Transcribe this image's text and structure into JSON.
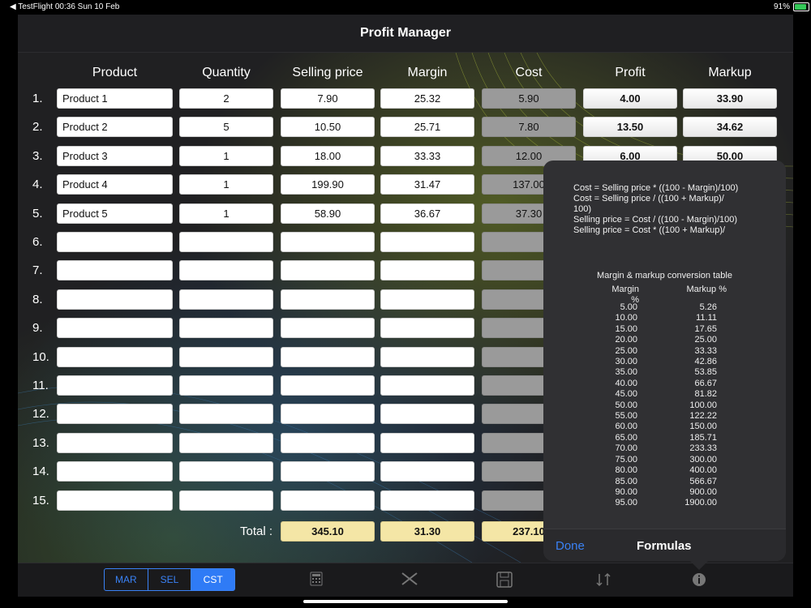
{
  "status": {
    "left": "◀ TestFlight   00:36   Sun 10 Feb",
    "right": "91%"
  },
  "app": {
    "title": "Profit Manager"
  },
  "headers": [
    "Product",
    "Quantity",
    "Selling price",
    "Margin",
    "Cost",
    "Profit",
    "Markup"
  ],
  "rows": [
    {
      "num": "1.",
      "product": "Product 1",
      "qty": "2",
      "sell": "7.90",
      "margin": "25.32",
      "cost": "5.90",
      "profit": "4.00",
      "markup": "33.90"
    },
    {
      "num": "2.",
      "product": "Product 2",
      "qty": "5",
      "sell": "10.50",
      "margin": "25.71",
      "cost": "7.80",
      "profit": "13.50",
      "markup": "34.62"
    },
    {
      "num": "3.",
      "product": "Product 3",
      "qty": "1",
      "sell": "18.00",
      "margin": "33.33",
      "cost": "12.00",
      "profit": "6.00",
      "markup": "50.00"
    },
    {
      "num": "4.",
      "product": "Product 4",
      "qty": "1",
      "sell": "199.90",
      "margin": "31.47",
      "cost": "137.00",
      "profit": "",
      "markup": ""
    },
    {
      "num": "5.",
      "product": "Product 5",
      "qty": "1",
      "sell": "58.90",
      "margin": "36.67",
      "cost": "37.30",
      "profit": "",
      "markup": ""
    },
    {
      "num": "6.",
      "product": "",
      "qty": "",
      "sell": "",
      "margin": "",
      "cost": "",
      "profit": "",
      "markup": ""
    },
    {
      "num": "7.",
      "product": "",
      "qty": "",
      "sell": "",
      "margin": "",
      "cost": "",
      "profit": "",
      "markup": ""
    },
    {
      "num": "8.",
      "product": "",
      "qty": "",
      "sell": "",
      "margin": "",
      "cost": "",
      "profit": "",
      "markup": ""
    },
    {
      "num": "9.",
      "product": "",
      "qty": "",
      "sell": "",
      "margin": "",
      "cost": "",
      "profit": "",
      "markup": ""
    },
    {
      "num": "10.",
      "product": "",
      "qty": "",
      "sell": "",
      "margin": "",
      "cost": "",
      "profit": "",
      "markup": ""
    },
    {
      "num": "11.",
      "product": "",
      "qty": "",
      "sell": "",
      "margin": "",
      "cost": "",
      "profit": "",
      "markup": ""
    },
    {
      "num": "12.",
      "product": "",
      "qty": "",
      "sell": "",
      "margin": "",
      "cost": "",
      "profit": "",
      "markup": ""
    },
    {
      "num": "13.",
      "product": "",
      "qty": "",
      "sell": "",
      "margin": "",
      "cost": "",
      "profit": "",
      "markup": ""
    },
    {
      "num": "14.",
      "product": "",
      "qty": "",
      "sell": "",
      "margin": "",
      "cost": "",
      "profit": "",
      "markup": ""
    },
    {
      "num": "15.",
      "product": "",
      "qty": "",
      "sell": "",
      "margin": "",
      "cost": "",
      "profit": "",
      "markup": ""
    }
  ],
  "totals": {
    "label": "Total :",
    "sell": "345.10",
    "margin": "31.30",
    "cost": "237.10"
  },
  "toolbar": {
    "segments": [
      "MAR",
      "SEL",
      "CST"
    ],
    "selected": "CST",
    "icons": [
      "calculator-icon",
      "scissors-icon",
      "save-icon",
      "swap-icon",
      "info-icon"
    ]
  },
  "popover": {
    "formulas": [
      "Cost = Selling price * ((100 - Margin)/100)",
      "Cost = Selling price / ((100 + Markup)/",
      "100)",
      "Selling price = Cost / ((100 - Margin)/100)",
      "Selling price = Cost * ((100 + Markup)/"
    ],
    "table_title": "Margin & markup conversion table",
    "col_margin": "Margin %",
    "col_markup": "Markup %",
    "margins": [
      "5.00",
      "10.00",
      "15.00",
      "20.00",
      "25.00",
      "30.00",
      "35.00",
      "40.00",
      "45.00",
      "50.00",
      "55.00",
      "60.00",
      "65.00",
      "70.00",
      "75.00",
      "80.00",
      "85.00",
      "90.00",
      "95.00"
    ],
    "markups": [
      "5.26",
      "11.11",
      "17.65",
      "25.00",
      "33.33",
      "42.86",
      "53.85",
      "66.67",
      "81.82",
      "100.00",
      "122.22",
      "150.00",
      "185.71",
      "233.33",
      "300.00",
      "400.00",
      "566.67",
      "900.00",
      "1900.00"
    ],
    "done": "Done",
    "title": "Formulas"
  }
}
